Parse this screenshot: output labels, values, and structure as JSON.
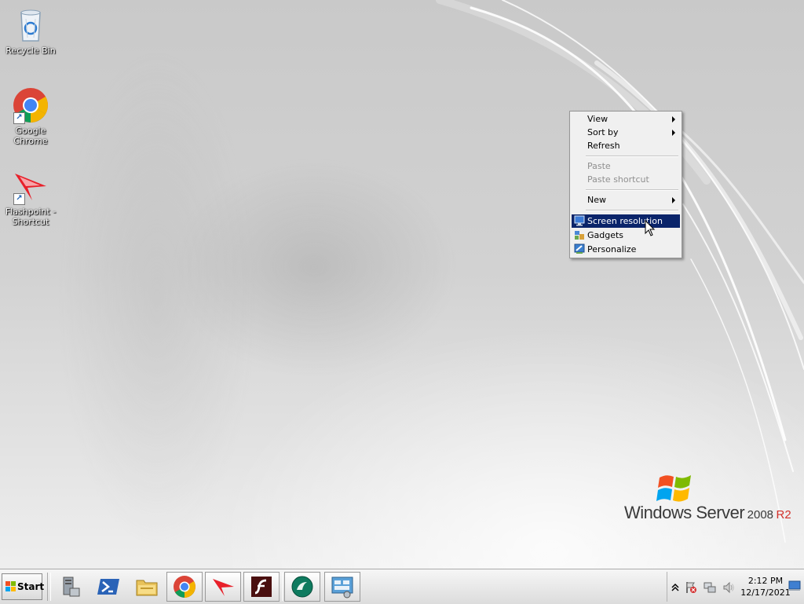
{
  "desktop": {
    "icons": [
      {
        "label": "Recycle Bin"
      },
      {
        "label": "Google Chrome"
      },
      {
        "label": "Flashpoint - Shortcut"
      }
    ]
  },
  "context_menu": {
    "items": [
      {
        "label": "View",
        "submenu": true,
        "enabled": true
      },
      {
        "label": "Sort by",
        "submenu": true,
        "enabled": true
      },
      {
        "label": "Refresh",
        "submenu": false,
        "enabled": true
      },
      {
        "label": "Paste",
        "submenu": false,
        "enabled": false
      },
      {
        "label": "Paste shortcut",
        "submenu": false,
        "enabled": false
      },
      {
        "label": "New",
        "submenu": true,
        "enabled": true
      },
      {
        "label": "Screen resolution",
        "submenu": false,
        "enabled": true,
        "selected": true,
        "icon": "monitor-icon"
      },
      {
        "label": "Gadgets",
        "submenu": false,
        "enabled": true,
        "icon": "gadgets-icon"
      },
      {
        "label": "Personalize",
        "submenu": false,
        "enabled": true,
        "icon": "personalize-icon"
      }
    ]
  },
  "branding": {
    "product": "Windows Server",
    "version": "2008",
    "edition": "R2"
  },
  "taskbar": {
    "start_label": "Start",
    "pinned": [
      {
        "icon": "server-manager-icon"
      },
      {
        "icon": "powershell-icon"
      },
      {
        "icon": "explorer-icon"
      },
      {
        "icon": "chrome-icon"
      },
      {
        "icon": "flashpoint-icon"
      },
      {
        "icon": "flash-player-icon"
      },
      {
        "icon": "green-circle-app-icon"
      },
      {
        "icon": "control-panel-icon"
      }
    ],
    "clock": {
      "time": "2:12 PM",
      "date": "12/17/2021"
    }
  },
  "colors": {
    "menu_highlight": "#0a246a",
    "brand_r2": "#d2302a",
    "taskbar_bg": "#dcdcdc"
  }
}
